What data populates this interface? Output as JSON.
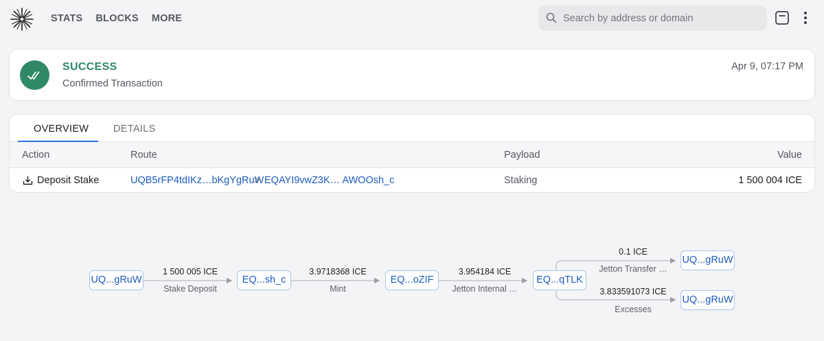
{
  "nav": {
    "stats": "STATS",
    "blocks": "BLOCKS",
    "more": "MORE"
  },
  "search": {
    "placeholder": "Search by address or domain"
  },
  "status": {
    "title": "SUCCESS",
    "subtitle": "Confirmed Transaction",
    "date": "Apr 9, 07:17 PM",
    "color": "#2f8866"
  },
  "tabs": {
    "overview": "OVERVIEW",
    "details": "DETAILS"
  },
  "table": {
    "headers": {
      "action": "Action",
      "route": "Route",
      "payload": "Payload",
      "value": "Value"
    },
    "row": {
      "action": "Deposit Stake",
      "route_from": "UQB5rFP4tdIKz…bKgYgRuW",
      "route_sep": ">",
      "route_to": "EQAYI9vwZ3K… AWOOsh_c",
      "payload": "Staking",
      "value": "1 500 004 ICE"
    }
  },
  "graph": {
    "nodes": {
      "n1": "UQ...gRuW",
      "n2": "EQ...sh_c",
      "n3": "EQ...oZIF",
      "n4": "EQ...qTLK",
      "n5": "UQ...gRuW",
      "n6": "UQ...gRuW"
    },
    "edges": {
      "e1": {
        "amount": "1 500 005 ICE",
        "label": "Stake Deposit"
      },
      "e2": {
        "amount": "3.9718368 ICE",
        "label": "Mint"
      },
      "e3": {
        "amount": "3.954184 ICE",
        "label": "Jetton Internal …"
      },
      "e4": {
        "amount": "0.1 ICE",
        "label": "Jetton Transfer …"
      },
      "e5": {
        "amount": "3.833591073 ICE",
        "label": "Excesses"
      }
    }
  },
  "colors": {
    "accent": "#1d5bbd",
    "success": "#2f8866",
    "tab_underline": "#2a6fdb"
  }
}
